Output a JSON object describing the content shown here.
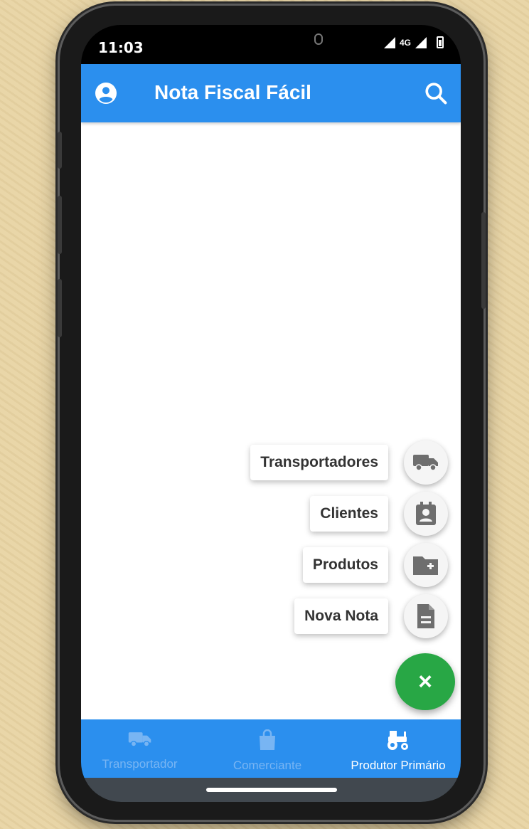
{
  "status_bar": {
    "time": "11:03",
    "network": "4G"
  },
  "app_bar": {
    "title": "Nota Fiscal Fácil",
    "left_icon": "account-circle-icon",
    "right_icon": "search-icon",
    "color": "#2b8fee"
  },
  "speed_dial": {
    "items": [
      {
        "label": "Transportadores",
        "icon": "truck-icon"
      },
      {
        "label": "Clientes",
        "icon": "contact-card-icon"
      },
      {
        "label": "Produtos",
        "icon": "folder-add-icon"
      },
      {
        "label": "Nova Nota",
        "icon": "document-icon"
      }
    ],
    "main_button": {
      "icon": "close-icon",
      "label": "×",
      "color": "#28a745"
    }
  },
  "bottom_nav": {
    "items": [
      {
        "label": "Transportador",
        "icon": "truck-icon",
        "active": false
      },
      {
        "label": "Comerciante",
        "icon": "shopping-bag-icon",
        "active": false
      },
      {
        "label": "Produtor Primário",
        "icon": "tractor-icon",
        "active": true
      }
    ]
  }
}
